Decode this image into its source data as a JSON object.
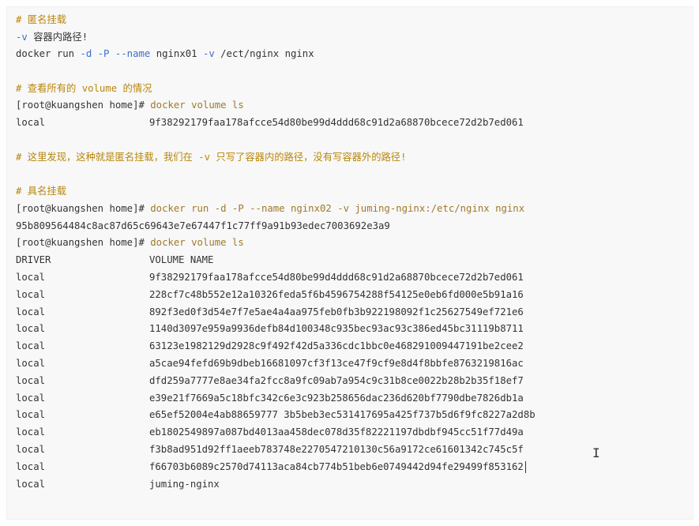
{
  "lines": {
    "anon_comment": "# 匿名挂载",
    "v_flag": "-v",
    "v_desc": " 容器内路径!",
    "run1_prefix": "docker run ",
    "run1_d": "-d",
    "run1_space1": " ",
    "run1_P": "-P",
    "run1_space2": " ",
    "run1_name": "--name",
    "run1_mid": " nginx01 ",
    "run1_v": "-v",
    "run1_rest": " /ect/nginx nginx",
    "view_comment": "# 查看所有的 volume 的情况",
    "prompt1": "[root@kuangshen home]# ",
    "ls_cmd1": "docker volume ls",
    "local_label": "local",
    "first_hash": "9f38292179faa178afcce54d80be99d4ddd68c91d2a68870bcece72d2b7ed061",
    "found_comment": "# 这里发现，这种就是匿名挂载，我们在 -v 只写了容器内的路径，没有写容器外的路径!",
    "named_comment": "# 具名挂载",
    "prompt2": "[root@kuangshen home]# ",
    "run2_cmd": "docker run -d -P --name nginx02 -v juming-nginx:/etc/nginx nginx",
    "run2_output": "95b809564484c8ac87d65c69643e7e67447f1c77ff9a91b93edec7003692e3a9",
    "prompt3": "[root@kuangshen home]# ",
    "ls_cmd2": "docker volume ls",
    "header_driver": "DRIVER",
    "header_volume": "VOLUME NAME"
  },
  "volumes": [
    {
      "driver": "local",
      "name": "9f38292179faa178afcce54d80be99d4ddd68c91d2a68870bcece72d2b7ed061"
    },
    {
      "driver": "local",
      "name": "228cf7c48b552e12a10326feda5f6b4596754288f54125e0eb6fd000e5b91a16"
    },
    {
      "driver": "local",
      "name": "892f3ed0f3d54e7f7e5ae4a4aa975feb0fb3b922198092f1c25627549ef721e6"
    },
    {
      "driver": "local",
      "name": "1140d3097e959a9936defb84d100348c935bec93ac93c386ed45bc31119b8711"
    },
    {
      "driver": "local",
      "name": "63123e1982129d2928c9f492f42d5a336cdc1bbc0e468291009447191be2cee2"
    },
    {
      "driver": "local",
      "name": "a5cae94fefd69b9dbeb16681097cf3f13ce47f9cf9e8d4f8bbfe8763219816ac"
    },
    {
      "driver": "local",
      "name": "dfd259a7777e8ae34fa2fcc8a9fc09ab7a954c9c31b8ce0022b28b2b35f18ef7"
    },
    {
      "driver": "local",
      "name": "e39e21f7669a5c18bfc342c6e3c923b258656dac236d620bf7790dbe7826db1a"
    },
    {
      "driver": "local",
      "name": "e65ef52004e4ab88659777 3b5beb3ec531417695a425f737b5d6f9fc8227a2d8b"
    },
    {
      "driver": "local",
      "name": "eb1802549897a087bd4013aa458dec078d35f82221197dbdbf945cc51f77d49a"
    },
    {
      "driver": "local",
      "name": "f3b8ad951d92ff1aeeb783748e2270547210130c56a9172ce61601342c745c5f"
    },
    {
      "driver": "local",
      "name": "f66703b6089c2570d74113aca84cb774b51beb6e0749442d94fe29499f853162"
    },
    {
      "driver": "local",
      "name": "juming-nginx"
    }
  ]
}
